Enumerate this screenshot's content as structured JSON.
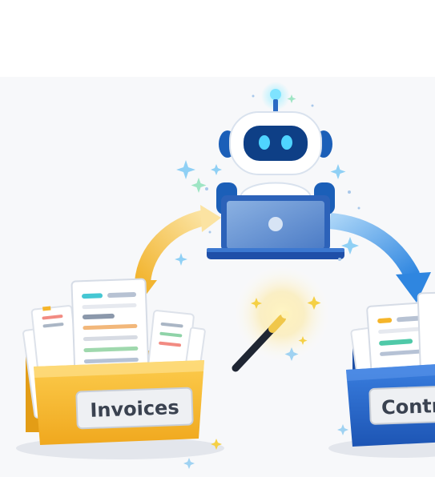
{
  "folders": {
    "left_label": "Invoices",
    "right_label": "Contr"
  },
  "colors": {
    "illustration_background": "#f7f8fa",
    "folder_yellow": "#f5b52a",
    "folder_yellow_light": "#fbd35a",
    "folder_blue": "#2f6fd6",
    "folder_blue_dark": "#1f4fa8",
    "arrow_yellow": "#f7c95c",
    "arrow_blue": "#4a9be8",
    "robot_blue": "#1b5fb8",
    "laptop_blue": "#2c62b9",
    "wand_spark": "#f5d045"
  },
  "icons": [
    "robot-icon",
    "laptop-icon",
    "magic-wand-icon",
    "sparkle-icon",
    "folder-icon",
    "document-icon",
    "arrow-icon"
  ]
}
